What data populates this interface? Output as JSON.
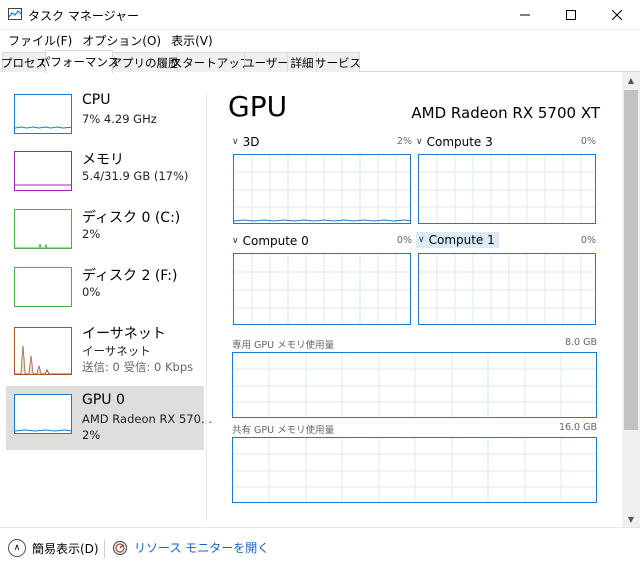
{
  "window": {
    "title": "タスク マネージャー"
  },
  "menu": [
    "ファイル(F)",
    "オプション(O)",
    "表示(V)"
  ],
  "tabs": [
    {
      "label": "プロセス",
      "active": false
    },
    {
      "label": "パフォーマンス",
      "active": true
    },
    {
      "label": "アプリの履歴",
      "active": false
    },
    {
      "label": "スタートアップ",
      "active": false
    },
    {
      "label": "ユーザー",
      "active": false
    },
    {
      "label": "詳細",
      "active": false
    },
    {
      "label": "サービス",
      "active": false
    }
  ],
  "sidebar": {
    "items": [
      {
        "title": "CPU",
        "sub1": "7%  4.29 GHz",
        "sub2": "",
        "color": "#1a7ad0"
      },
      {
        "title": "メモリ",
        "sub1": "5.4/31.9 GB (17%)",
        "sub2": "",
        "color": "#9c27b0"
      },
      {
        "title": "ディスク 0 (C:)",
        "sub1": "2%",
        "sub2": "",
        "color": "#4caf50"
      },
      {
        "title": "ディスク 2 (F:)",
        "sub1": "0%",
        "sub2": "",
        "color": "#4caf50"
      },
      {
        "title": "イーサネット",
        "sub1": "イーサネット",
        "sub2": "送信: 0  受信: 0 Kbps",
        "color": "#a0522d"
      },
      {
        "title": "GPU 0",
        "sub1": "AMD Radeon RX 570...",
        "sub2": "2%",
        "color": "#1a7ad0"
      }
    ]
  },
  "main": {
    "title": "GPU",
    "model": "AMD Radeon RX 5700 XT",
    "engines": [
      {
        "label": "3D",
        "percent": "2%"
      },
      {
        "label": "Compute 3",
        "percent": "0%"
      },
      {
        "label": "Compute 0",
        "percent": "0%"
      },
      {
        "label": "Compute 1",
        "percent": "0%"
      }
    ],
    "dedicated_memory_label": "専用 GPU メモリ使用量",
    "dedicated_memory_max": "8.0 GB",
    "shared_memory_label": "共有 GPU メモリ使用量",
    "shared_memory_max": "16.0 GB"
  },
  "footer": {
    "fewer_details": "簡易表示(D)",
    "open_monitor": "リソース モニターを開く"
  },
  "colors": {
    "accent": "#1a7ad0",
    "link": "#1565c0",
    "selected_bg": "#dedede"
  }
}
